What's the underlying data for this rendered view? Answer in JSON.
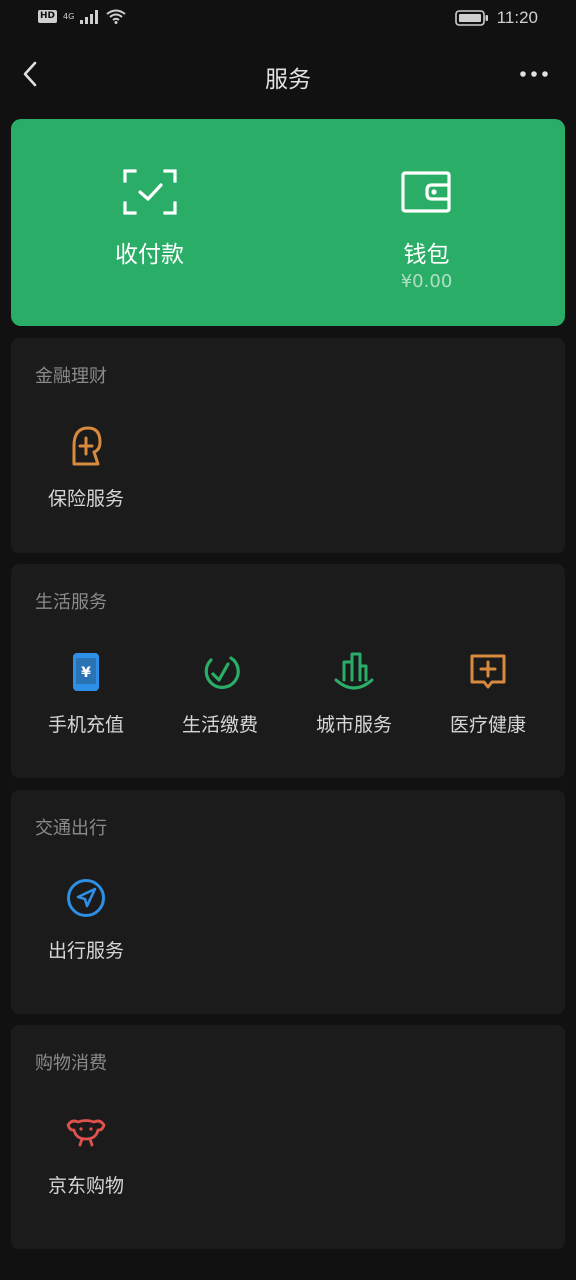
{
  "status_bar": {
    "left_badge": "HD",
    "network": "4G",
    "time": "11:20",
    "icons": [
      "signal-icon",
      "wifi-icon",
      "battery-icon"
    ]
  },
  "nav": {
    "title": "服务",
    "back_icon": "chevron-left-icon",
    "more_icon": "more-dots-icon"
  },
  "hero": {
    "background_color": "#2aae67",
    "items": [
      {
        "label": "收付款",
        "sub": "",
        "icon": "scan-check-icon"
      },
      {
        "label": "钱包",
        "sub": "¥0.00",
        "icon": "wallet-icon"
      }
    ]
  },
  "sections": [
    {
      "title": "金融理财",
      "items": [
        {
          "label": "保险服务",
          "icon": "insurance-icon",
          "color": "#d88a3e"
        }
      ]
    },
    {
      "title": "生活服务",
      "items": [
        {
          "label": "手机充值",
          "icon": "mobile-topup-icon",
          "color": "#2e8fe6"
        },
        {
          "label": "生活缴费",
          "icon": "utility-bill-icon",
          "color": "#2aae67"
        },
        {
          "label": "城市服务",
          "icon": "city-service-icon",
          "color": "#2aae67"
        },
        {
          "label": "医疗健康",
          "icon": "medical-icon",
          "color": "#d88a3e"
        }
      ]
    },
    {
      "title": "交通出行",
      "items": [
        {
          "label": "出行服务",
          "icon": "navigation-icon",
          "color": "#2e8fe6"
        }
      ]
    },
    {
      "title": "购物消费",
      "items": [
        {
          "label": "京东购物",
          "icon": "jd-dog-icon",
          "color": "#e0524e"
        }
      ]
    }
  ]
}
